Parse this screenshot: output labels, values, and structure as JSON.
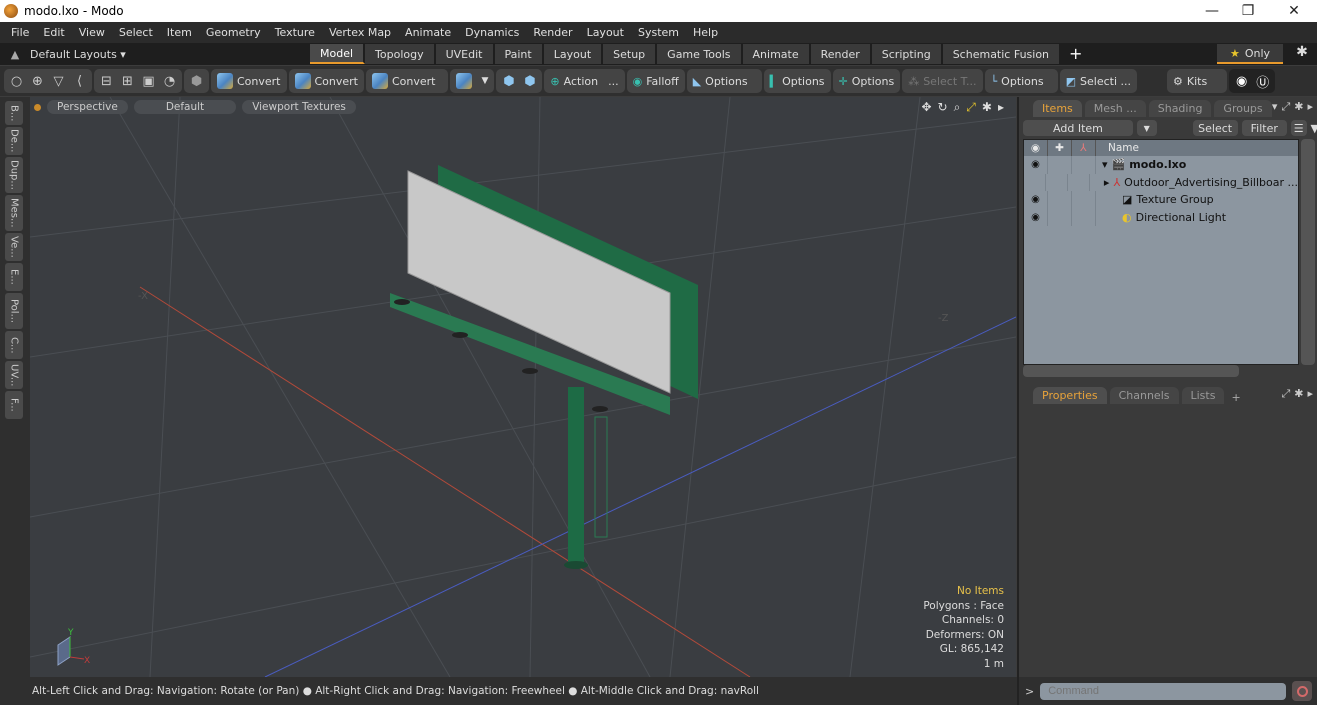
{
  "window": {
    "title": "modo.lxo - Modo",
    "controls": {
      "minimize": "—",
      "restore": "❐",
      "close": "✕"
    }
  },
  "menu": [
    "File",
    "Edit",
    "View",
    "Select",
    "Item",
    "Geometry",
    "Texture",
    "Vertex Map",
    "Animate",
    "Dynamics",
    "Render",
    "Layout",
    "System",
    "Help"
  ],
  "layouts": {
    "switcher_label": "Default Layouts ▾",
    "tabs": [
      "Model",
      "Topology",
      "UVEdit",
      "Paint",
      "Layout",
      "Setup",
      "Game Tools",
      "Animate",
      "Render",
      "Scripting",
      "Schematic Fusion"
    ],
    "active_tab": "Model",
    "add_label": "+",
    "only_label": "Only"
  },
  "toolbar": {
    "convert1": "Convert",
    "convert2": "Convert",
    "convert3": "Convert",
    "action": "Action",
    "action_more": "...",
    "falloff": "Falloff",
    "options1": "Options",
    "options2": "Options",
    "options3": "Options",
    "select_t": "Select T...",
    "options4": "Options",
    "selecti": "Selecti ...",
    "kits": "Kits"
  },
  "left_tabs": [
    "B...",
    "De...",
    "Dup...",
    "Mes...",
    "Ve...",
    "E...",
    "Pol...",
    "C...",
    "UV...",
    "F..."
  ],
  "viewport": {
    "view": "Perspective",
    "shading": "Default",
    "textures": "Viewport Textures",
    "info": {
      "selection": "No Items",
      "polygons": "Polygons : Face",
      "channels": "Channels: 0",
      "deformers": "Deformers: ON",
      "gl": "GL: 865,142",
      "scale": "1 m"
    },
    "axis_labels": {
      "x": "X",
      "y": "Y",
      "neg_x": "-X",
      "neg_z": "-Z"
    }
  },
  "status_bar": "Alt-Left Click and Drag: Navigation: Rotate (or Pan) ● Alt-Right Click and Drag: Navigation: Freewheel ● Alt-Middle Click and Drag: navRoll",
  "items_panel": {
    "tabs": [
      "Items",
      "Mesh ...",
      "Shading",
      "Groups"
    ],
    "active_tab": "Items",
    "add_item": "Add Item",
    "select": "Select",
    "filter": "Filter",
    "column_name": "Name",
    "items": [
      {
        "name": "modo.lxo",
        "visible": true,
        "bold": true
      },
      {
        "name": "Outdoor_Advertising_Billboar ...",
        "visible": false
      },
      {
        "name": "Texture Group",
        "visible": true
      },
      {
        "name": "Directional Light",
        "visible": true
      }
    ]
  },
  "properties_panel": {
    "tabs": [
      "Properties",
      "Channels",
      "Lists"
    ],
    "active_tab": "Properties",
    "add_label": "+"
  },
  "command": {
    "prompt": ">",
    "placeholder": "Command"
  },
  "colors": {
    "accent": "#e89a2c",
    "billboard_green": "#1f6b45",
    "panel_face": "#c8c8c8"
  }
}
